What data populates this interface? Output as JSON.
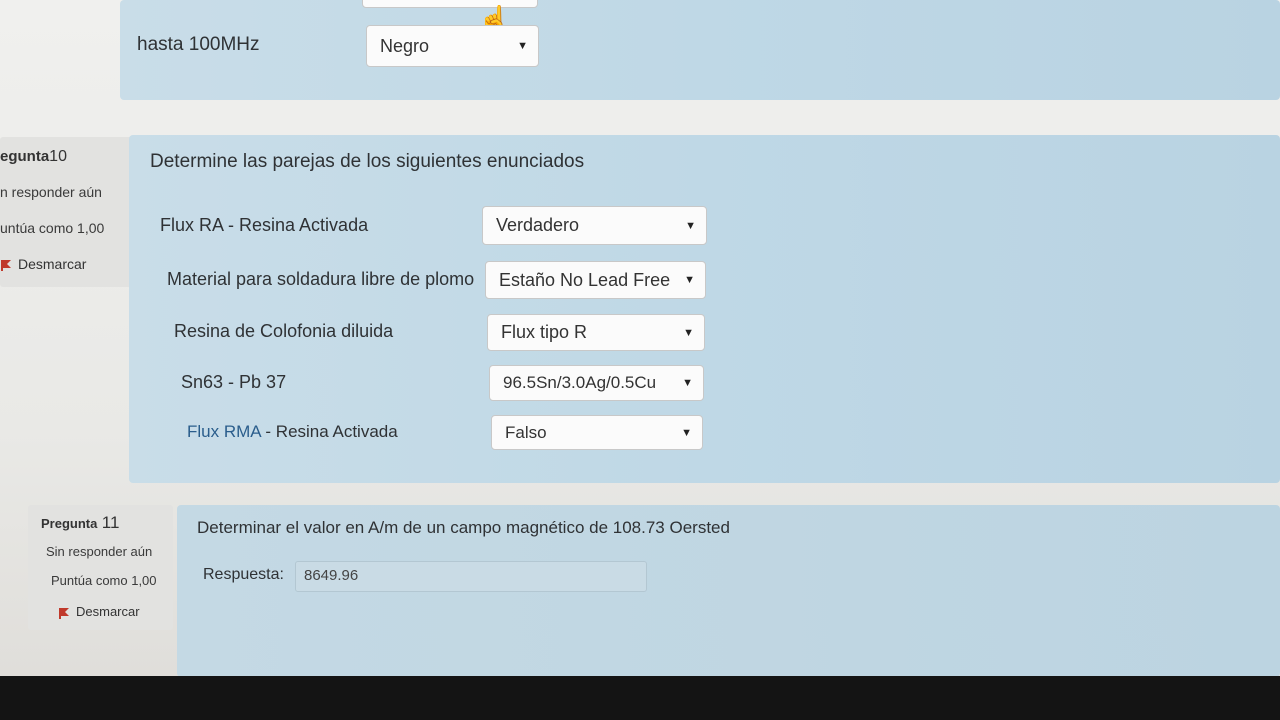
{
  "q9_partial": {
    "row_label": "hasta 100MHz",
    "select_value": "Negro"
  },
  "q10": {
    "info": {
      "title_prefix": "egunta",
      "number": "10",
      "status": "n responder aún",
      "score": "untúa como 1,00",
      "flag_label": "Desmarcar"
    },
    "question": "Determine las parejas de los siguientes enunciados",
    "rows": [
      {
        "label": "Flux RA - Resina Activada",
        "value": "Verdadero"
      },
      {
        "label": "Material para soldadura libre de plomo",
        "value": "Estaño No Lead Free"
      },
      {
        "label": "Resina de Colofonia diluida",
        "value": "Flux tipo R"
      },
      {
        "label": "Sn63 - Pb 37",
        "value": "96.5Sn/3.0Ag/0.5Cu"
      },
      {
        "label_link": "Flux RMA",
        "label_rest": " - Resina Activada",
        "value": "Falso"
      }
    ]
  },
  "q11": {
    "info": {
      "title_prefix": "Pregunta",
      "number": "11",
      "status": "Sin responder aún",
      "score": "Puntúa como 1,00",
      "flag_label": "Desmarcar"
    },
    "question": "Determinar el valor en A/m de un campo magnético de 108.73 Oersted",
    "answer_label": "Respuesta:",
    "answer_value": "8649.96"
  },
  "colors": {
    "block_bg": "#bfd8e6",
    "info_bg": "#e2e2e0",
    "link": "#2a5d8c",
    "flag": "#c0392b"
  }
}
